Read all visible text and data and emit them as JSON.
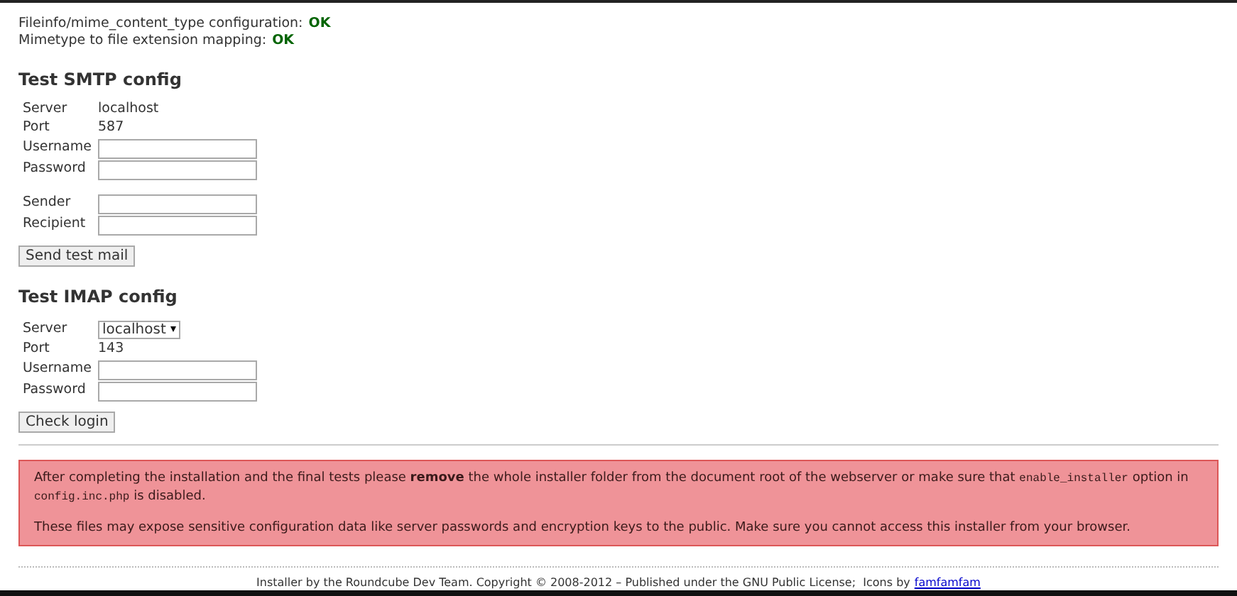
{
  "filetype_section": {
    "checks": [
      {
        "label": "Fileinfo/mime_content_type configuration:",
        "result": "OK"
      },
      {
        "label": "Mimetype to file extension mapping:",
        "result": "OK"
      }
    ]
  },
  "smtp": {
    "heading": "Test SMTP config",
    "rows": [
      {
        "kind": "text",
        "label": "Server",
        "value": "localhost"
      },
      {
        "kind": "text",
        "label": "Port",
        "value": "587"
      },
      {
        "kind": "input",
        "label": "Username"
      },
      {
        "kind": "input",
        "label": "Password"
      },
      {
        "kind": "spacer"
      },
      {
        "kind": "input",
        "label": "Sender"
      },
      {
        "kind": "input",
        "label": "Recipient"
      }
    ],
    "button": "Send test mail"
  },
  "imap": {
    "heading": "Test IMAP config",
    "rows": [
      {
        "kind": "select",
        "label": "Server",
        "value": "localhost"
      },
      {
        "kind": "text",
        "label": "Port",
        "value": "143"
      },
      {
        "kind": "input",
        "label": "Username"
      },
      {
        "kind": "input",
        "label": "Password"
      }
    ],
    "button": "Check login"
  },
  "warning": {
    "paragraphs": [
      [
        {
          "kind": "text",
          "text": "After completing the installation and the final tests please "
        },
        {
          "kind": "bold",
          "text": "remove"
        },
        {
          "kind": "text",
          "text": " the whole installer folder from the document root of the webserver or make sure that "
        },
        {
          "kind": "code",
          "text": "enable_installer"
        },
        {
          "kind": "text",
          "text": " option in "
        },
        {
          "kind": "code",
          "text": "config.inc.php"
        },
        {
          "kind": "text",
          "text": " is disabled."
        }
      ],
      [
        {
          "kind": "text",
          "text": "These files may expose sensitive configuration data like server passwords and encryption keys to the public. Make sure you cannot access this installer from your browser."
        }
      ]
    ]
  },
  "footer": {
    "text": "Installer by the Roundcube Dev Team. Copyright © 2008-2012 – Published under the GNU Public License;  Icons by",
    "link": "famfamfam"
  }
}
